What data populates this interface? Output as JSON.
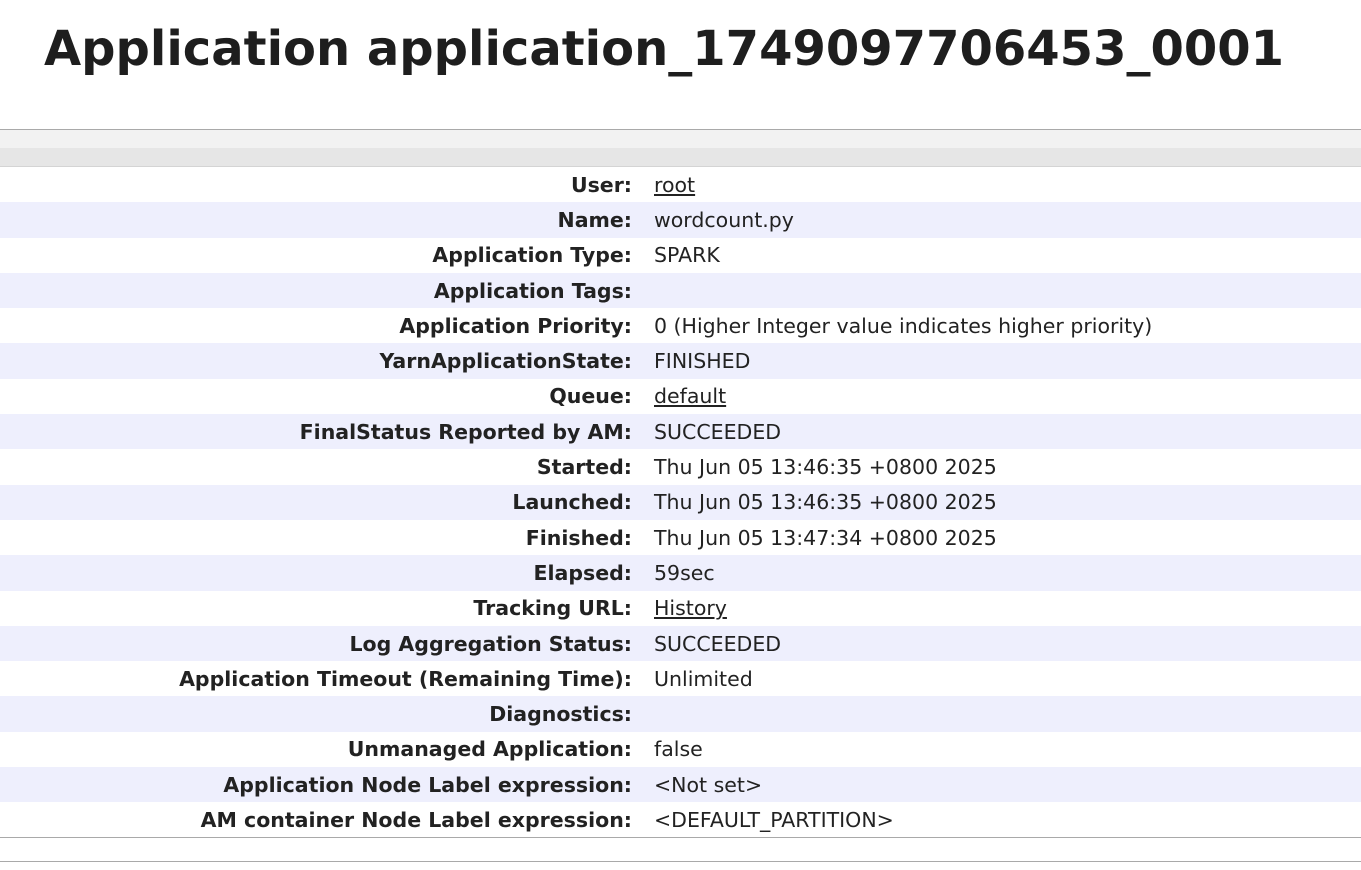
{
  "page": {
    "title": "Application application_1749097706453_0001"
  },
  "overview": {
    "rows": [
      {
        "label": "User:",
        "value": "root",
        "link": true
      },
      {
        "label": "Name:",
        "value": "wordcount.py",
        "link": false
      },
      {
        "label": "Application Type:",
        "value": "SPARK",
        "link": false
      },
      {
        "label": "Application Tags:",
        "value": "",
        "link": false
      },
      {
        "label": "Application Priority:",
        "value": "0 (Higher Integer value indicates higher priority)",
        "link": false
      },
      {
        "label": "YarnApplicationState:",
        "value": "FINISHED",
        "link": false
      },
      {
        "label": "Queue:",
        "value": "default",
        "link": true
      },
      {
        "label": "FinalStatus Reported by AM:",
        "value": "SUCCEEDED",
        "link": false
      },
      {
        "label": "Started:",
        "value": "Thu Jun 05 13:46:35 +0800 2025",
        "link": false
      },
      {
        "label": "Launched:",
        "value": "Thu Jun 05 13:46:35 +0800 2025",
        "link": false
      },
      {
        "label": "Finished:",
        "value": "Thu Jun 05 13:47:34 +0800 2025",
        "link": false
      },
      {
        "label": "Elapsed:",
        "value": "59sec",
        "link": false
      },
      {
        "label": "Tracking URL:",
        "value": "History",
        "link": true
      },
      {
        "label": "Log Aggregation Status:",
        "value": "SUCCEEDED",
        "link": false
      },
      {
        "label": "Application Timeout (Remaining Time):",
        "value": "Unlimited",
        "link": false
      },
      {
        "label": "Diagnostics:",
        "value": "",
        "link": false
      },
      {
        "label": "Unmanaged Application:",
        "value": "false",
        "link": false
      },
      {
        "label": "Application Node Label expression:",
        "value": "<Not set>",
        "link": false
      },
      {
        "label": "AM container Node Label expression:",
        "value": "<DEFAULT_PARTITION>",
        "link": false
      }
    ]
  }
}
